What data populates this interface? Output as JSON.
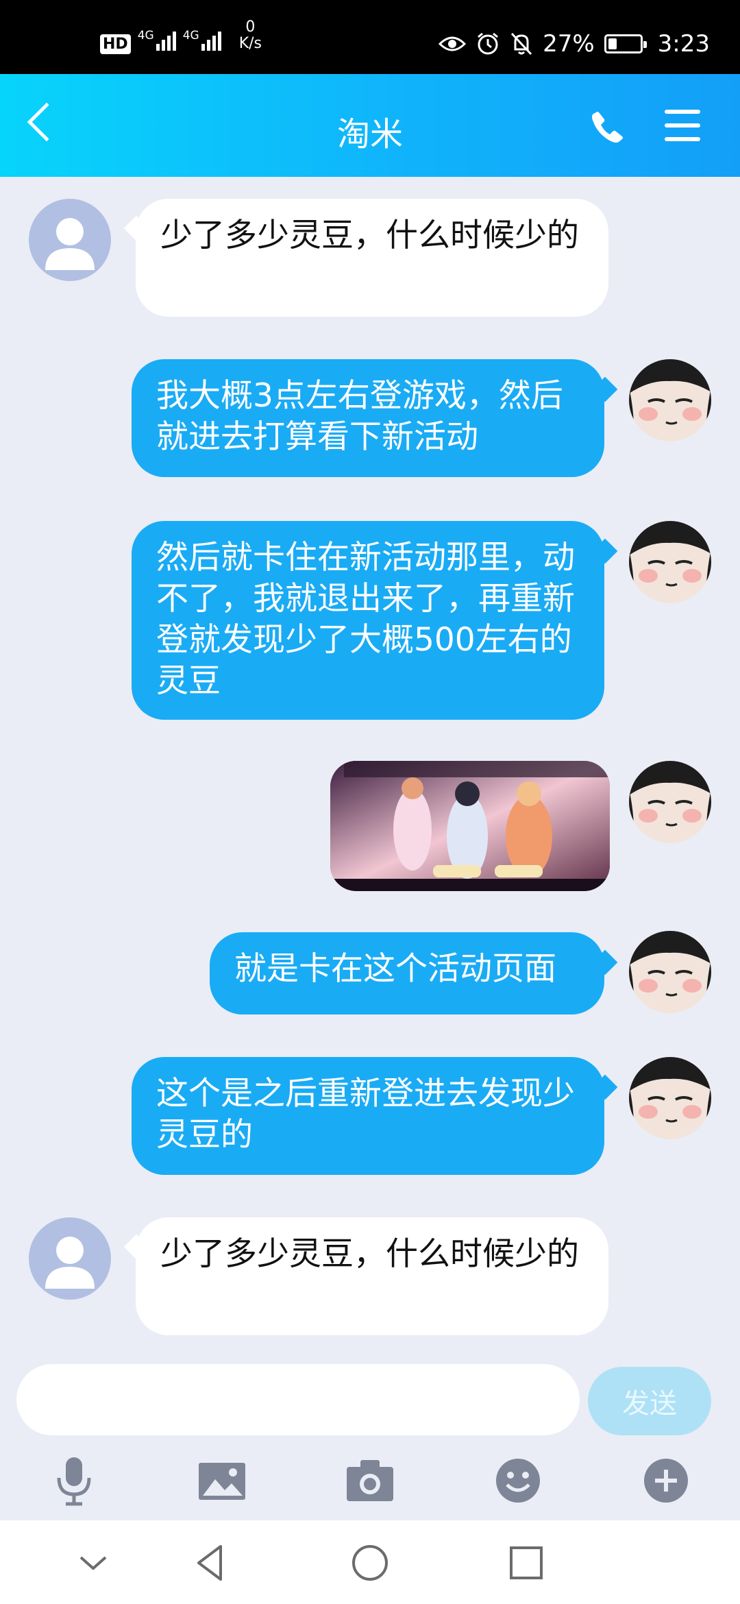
{
  "status_bar": {
    "network_1": "4G",
    "network_2": "4G",
    "speed_value": "0",
    "speed_unit": "K/s",
    "battery_percent": "27%",
    "battery_level": 0.27,
    "time": "3:23"
  },
  "header": {
    "title": "淘米"
  },
  "messages": [
    {
      "side": "left",
      "text": "少了多少灵豆，什么时候少的"
    },
    {
      "side": "right",
      "text": "我大概3点左右登游戏，然后就进去打算看下新活动"
    },
    {
      "side": "right",
      "text": "然后就卡住在新活动那里，动不了，我就退出来了，再重新登就发现少了大概500左右的灵豆"
    },
    {
      "side": "right",
      "type": "image"
    },
    {
      "side": "right",
      "text": "就是卡在这个活动页面"
    },
    {
      "side": "right",
      "text": "这个是之后重新登进去发现少灵豆的"
    },
    {
      "side": "left",
      "text": "少了多少灵豆，什么时候少的"
    }
  ],
  "composer": {
    "input_value": "",
    "send_label": "发送"
  },
  "toolbar_icons": [
    "microphone-icon",
    "image-icon",
    "camera-icon",
    "emoji-icon",
    "plus-icon"
  ],
  "colors": {
    "accent": "#1aabf5",
    "header_start": "#07d4fb",
    "header_end": "#139ff8",
    "background": "#eaedf5"
  }
}
